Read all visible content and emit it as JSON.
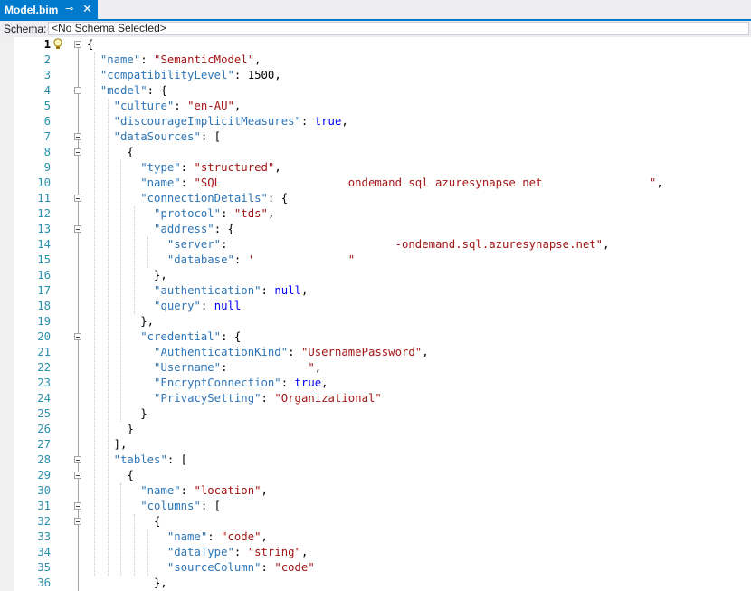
{
  "tab": {
    "title": "Model.bim",
    "pin_glyph": "⊸",
    "close_glyph": "✕"
  },
  "schema": {
    "label": "Schema:",
    "value": "<No Schema Selected>"
  },
  "editor": {
    "lines": [
      {
        "n": "1",
        "fold": true,
        "tokens": [
          {
            "t": "p",
            "v": "{"
          }
        ]
      },
      {
        "n": "2",
        "tokens": [
          {
            "t": "p",
            "v": "  "
          },
          {
            "t": "k",
            "v": "\"name\""
          },
          {
            "t": "p",
            "v": ": "
          },
          {
            "t": "s",
            "v": "\"SemanticModel\""
          },
          {
            "t": "p",
            "v": ","
          }
        ]
      },
      {
        "n": "3",
        "tokens": [
          {
            "t": "p",
            "v": "  "
          },
          {
            "t": "k",
            "v": "\"compatibilityLevel\""
          },
          {
            "t": "p",
            "v": ": "
          },
          {
            "t": "p",
            "v": "1500"
          },
          {
            "t": "p",
            "v": ","
          }
        ]
      },
      {
        "n": "4",
        "fold": true,
        "tokens": [
          {
            "t": "p",
            "v": "  "
          },
          {
            "t": "k",
            "v": "\"model\""
          },
          {
            "t": "p",
            "v": ": {"
          }
        ]
      },
      {
        "n": "5",
        "tokens": [
          {
            "t": "p",
            "v": "    "
          },
          {
            "t": "k",
            "v": "\"culture\""
          },
          {
            "t": "p",
            "v": ": "
          },
          {
            "t": "s",
            "v": "\"en-AU\""
          },
          {
            "t": "p",
            "v": ","
          }
        ]
      },
      {
        "n": "6",
        "tokens": [
          {
            "t": "p",
            "v": "    "
          },
          {
            "t": "k",
            "v": "\"discourageImplicitMeasures\""
          },
          {
            "t": "p",
            "v": ": "
          },
          {
            "t": "kw",
            "v": "true"
          },
          {
            "t": "p",
            "v": ","
          }
        ]
      },
      {
        "n": "7",
        "fold": true,
        "tokens": [
          {
            "t": "p",
            "v": "    "
          },
          {
            "t": "k",
            "v": "\"dataSources\""
          },
          {
            "t": "p",
            "v": ": ["
          }
        ]
      },
      {
        "n": "8",
        "fold": true,
        "tokens": [
          {
            "t": "p",
            "v": "      {"
          }
        ]
      },
      {
        "n": "9",
        "tokens": [
          {
            "t": "p",
            "v": "        "
          },
          {
            "t": "k",
            "v": "\"type\""
          },
          {
            "t": "p",
            "v": ": "
          },
          {
            "t": "s",
            "v": "\"structured\""
          },
          {
            "t": "p",
            "v": ","
          }
        ]
      },
      {
        "n": "10",
        "tokens": [
          {
            "t": "p",
            "v": "        "
          },
          {
            "t": "k",
            "v": "\"name\""
          },
          {
            "t": "p",
            "v": ": "
          },
          {
            "t": "s",
            "v": "\"SQL                   ondemand sql azuresynapse net                \""
          },
          {
            "t": "p",
            "v": ","
          }
        ]
      },
      {
        "n": "11",
        "fold": true,
        "tokens": [
          {
            "t": "p",
            "v": "        "
          },
          {
            "t": "k",
            "v": "\"connectionDetails\""
          },
          {
            "t": "p",
            "v": ": {"
          }
        ]
      },
      {
        "n": "12",
        "tokens": [
          {
            "t": "p",
            "v": "          "
          },
          {
            "t": "k",
            "v": "\"protocol\""
          },
          {
            "t": "p",
            "v": ": "
          },
          {
            "t": "s",
            "v": "\"tds\""
          },
          {
            "t": "p",
            "v": ","
          }
        ]
      },
      {
        "n": "13",
        "fold": true,
        "tokens": [
          {
            "t": "p",
            "v": "          "
          },
          {
            "t": "k",
            "v": "\"address\""
          },
          {
            "t": "p",
            "v": ": {"
          }
        ]
      },
      {
        "n": "14",
        "tokens": [
          {
            "t": "p",
            "v": "            "
          },
          {
            "t": "k",
            "v": "\"server\""
          },
          {
            "t": "p",
            "v": ":                         "
          },
          {
            "t": "s",
            "v": "-ondemand.sql.azuresynapse.net\""
          },
          {
            "t": "p",
            "v": ","
          }
        ]
      },
      {
        "n": "15",
        "tokens": [
          {
            "t": "p",
            "v": "            "
          },
          {
            "t": "k",
            "v": "\"database\""
          },
          {
            "t": "p",
            "v": ": "
          },
          {
            "t": "s",
            "v": "'              \""
          }
        ]
      },
      {
        "n": "16",
        "tokens": [
          {
            "t": "p",
            "v": "          },"
          }
        ]
      },
      {
        "n": "17",
        "tokens": [
          {
            "t": "p",
            "v": "          "
          },
          {
            "t": "k",
            "v": "\"authentication\""
          },
          {
            "t": "p",
            "v": ": "
          },
          {
            "t": "kw",
            "v": "null"
          },
          {
            "t": "p",
            "v": ","
          }
        ]
      },
      {
        "n": "18",
        "tokens": [
          {
            "t": "p",
            "v": "          "
          },
          {
            "t": "k",
            "v": "\"query\""
          },
          {
            "t": "p",
            "v": ": "
          },
          {
            "t": "kw",
            "v": "null"
          }
        ]
      },
      {
        "n": "19",
        "tokens": [
          {
            "t": "p",
            "v": "        },"
          }
        ]
      },
      {
        "n": "20",
        "fold": true,
        "tokens": [
          {
            "t": "p",
            "v": "        "
          },
          {
            "t": "k",
            "v": "\"credential\""
          },
          {
            "t": "p",
            "v": ": {"
          }
        ]
      },
      {
        "n": "21",
        "tokens": [
          {
            "t": "p",
            "v": "          "
          },
          {
            "t": "k",
            "v": "\"AuthenticationKind\""
          },
          {
            "t": "p",
            "v": ": "
          },
          {
            "t": "s",
            "v": "\"UsernamePassword\""
          },
          {
            "t": "p",
            "v": ","
          }
        ]
      },
      {
        "n": "22",
        "tokens": [
          {
            "t": "p",
            "v": "          "
          },
          {
            "t": "k",
            "v": "\"Username\""
          },
          {
            "t": "p",
            "v": ":            "
          },
          {
            "t": "s",
            "v": "\""
          },
          {
            "t": "p",
            "v": ","
          }
        ]
      },
      {
        "n": "23",
        "tokens": [
          {
            "t": "p",
            "v": "          "
          },
          {
            "t": "k",
            "v": "\"EncryptConnection\""
          },
          {
            "t": "p",
            "v": ": "
          },
          {
            "t": "kw",
            "v": "true"
          },
          {
            "t": "p",
            "v": ","
          }
        ]
      },
      {
        "n": "24",
        "tokens": [
          {
            "t": "p",
            "v": "          "
          },
          {
            "t": "k",
            "v": "\"PrivacySetting\""
          },
          {
            "t": "p",
            "v": ": "
          },
          {
            "t": "s",
            "v": "\"Organizational\""
          }
        ]
      },
      {
        "n": "25",
        "tokens": [
          {
            "t": "p",
            "v": "        }"
          }
        ]
      },
      {
        "n": "26",
        "tokens": [
          {
            "t": "p",
            "v": "      }"
          }
        ]
      },
      {
        "n": "27",
        "tokens": [
          {
            "t": "p",
            "v": "    ],"
          }
        ]
      },
      {
        "n": "28",
        "fold": true,
        "tokens": [
          {
            "t": "p",
            "v": "    "
          },
          {
            "t": "k",
            "v": "\"tables\""
          },
          {
            "t": "p",
            "v": ": ["
          }
        ]
      },
      {
        "n": "29",
        "fold": true,
        "tokens": [
          {
            "t": "p",
            "v": "      {"
          }
        ]
      },
      {
        "n": "30",
        "tokens": [
          {
            "t": "p",
            "v": "        "
          },
          {
            "t": "k",
            "v": "\"name\""
          },
          {
            "t": "p",
            "v": ": "
          },
          {
            "t": "s",
            "v": "\"location\""
          },
          {
            "t": "p",
            "v": ","
          }
        ]
      },
      {
        "n": "31",
        "fold": true,
        "tokens": [
          {
            "t": "p",
            "v": "        "
          },
          {
            "t": "k",
            "v": "\"columns\""
          },
          {
            "t": "p",
            "v": ": ["
          }
        ]
      },
      {
        "n": "32",
        "fold": true,
        "tokens": [
          {
            "t": "p",
            "v": "          {"
          }
        ]
      },
      {
        "n": "33",
        "tokens": [
          {
            "t": "p",
            "v": "            "
          },
          {
            "t": "k",
            "v": "\"name\""
          },
          {
            "t": "p",
            "v": ": "
          },
          {
            "t": "s",
            "v": "\"code\""
          },
          {
            "t": "p",
            "v": ","
          }
        ]
      },
      {
        "n": "34",
        "tokens": [
          {
            "t": "p",
            "v": "            "
          },
          {
            "t": "k",
            "v": "\"dataType\""
          },
          {
            "t": "p",
            "v": ": "
          },
          {
            "t": "s",
            "v": "\"string\""
          },
          {
            "t": "p",
            "v": ","
          }
        ]
      },
      {
        "n": "35",
        "tokens": [
          {
            "t": "p",
            "v": "            "
          },
          {
            "t": "k",
            "v": "\"sourceColumn\""
          },
          {
            "t": "p",
            "v": ": "
          },
          {
            "t": "s",
            "v": "\"code\""
          }
        ]
      },
      {
        "n": "36",
        "tokens": [
          {
            "t": "p",
            "v": "          },"
          }
        ]
      }
    ]
  }
}
